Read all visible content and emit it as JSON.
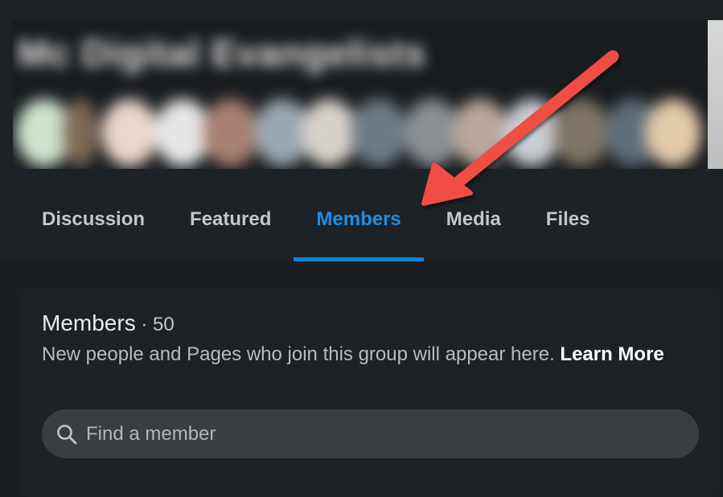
{
  "group": {
    "name": "Mc Digital Evangelists"
  },
  "tabs": [
    {
      "label": "Discussion",
      "active": false
    },
    {
      "label": "Featured",
      "active": false
    },
    {
      "label": "Members",
      "active": true
    },
    {
      "label": "Media",
      "active": false
    },
    {
      "label": "Files",
      "active": false
    }
  ],
  "members": {
    "title": "Members",
    "separator": " · ",
    "count": "50",
    "description": "New people and Pages who join this group will appear here.",
    "learn_more": "Learn More"
  },
  "search": {
    "placeholder": "Find a member",
    "value": "",
    "icon": "search-icon"
  },
  "colors": {
    "background": "#1b1f23",
    "surface": "#1d2226",
    "accent": "#0a86d6",
    "annotation": "#f04e45"
  }
}
